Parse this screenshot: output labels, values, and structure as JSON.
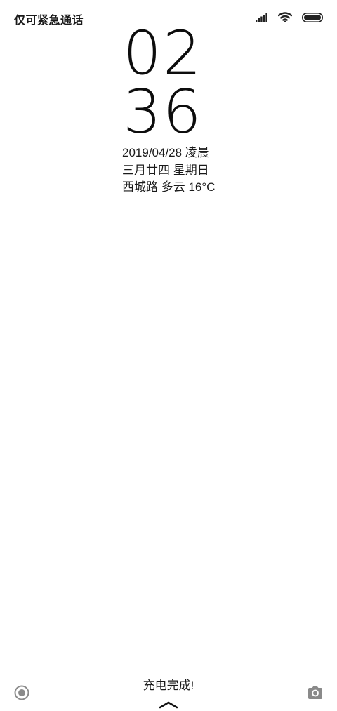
{
  "status_bar": {
    "carrier_text": "仅可紧急通话",
    "icons": [
      "signal-icon",
      "wifi-icon",
      "battery-icon"
    ],
    "battery_level": 1.0
  },
  "clock": {
    "hours": "02",
    "minutes": "36"
  },
  "info": {
    "date": "2019/04/28 凌晨",
    "lunar": "三月廿四  星期日",
    "weather": "西城路 多云 16°C"
  },
  "bottom": {
    "charge_status": "充电完成!",
    "left_icon": "record-icon",
    "right_icon": "camera-icon",
    "swipe_icon": "chevron-up-icon"
  },
  "colors": {
    "background": "#ffffff",
    "text": "#111111",
    "icon_gray": "#888888"
  }
}
